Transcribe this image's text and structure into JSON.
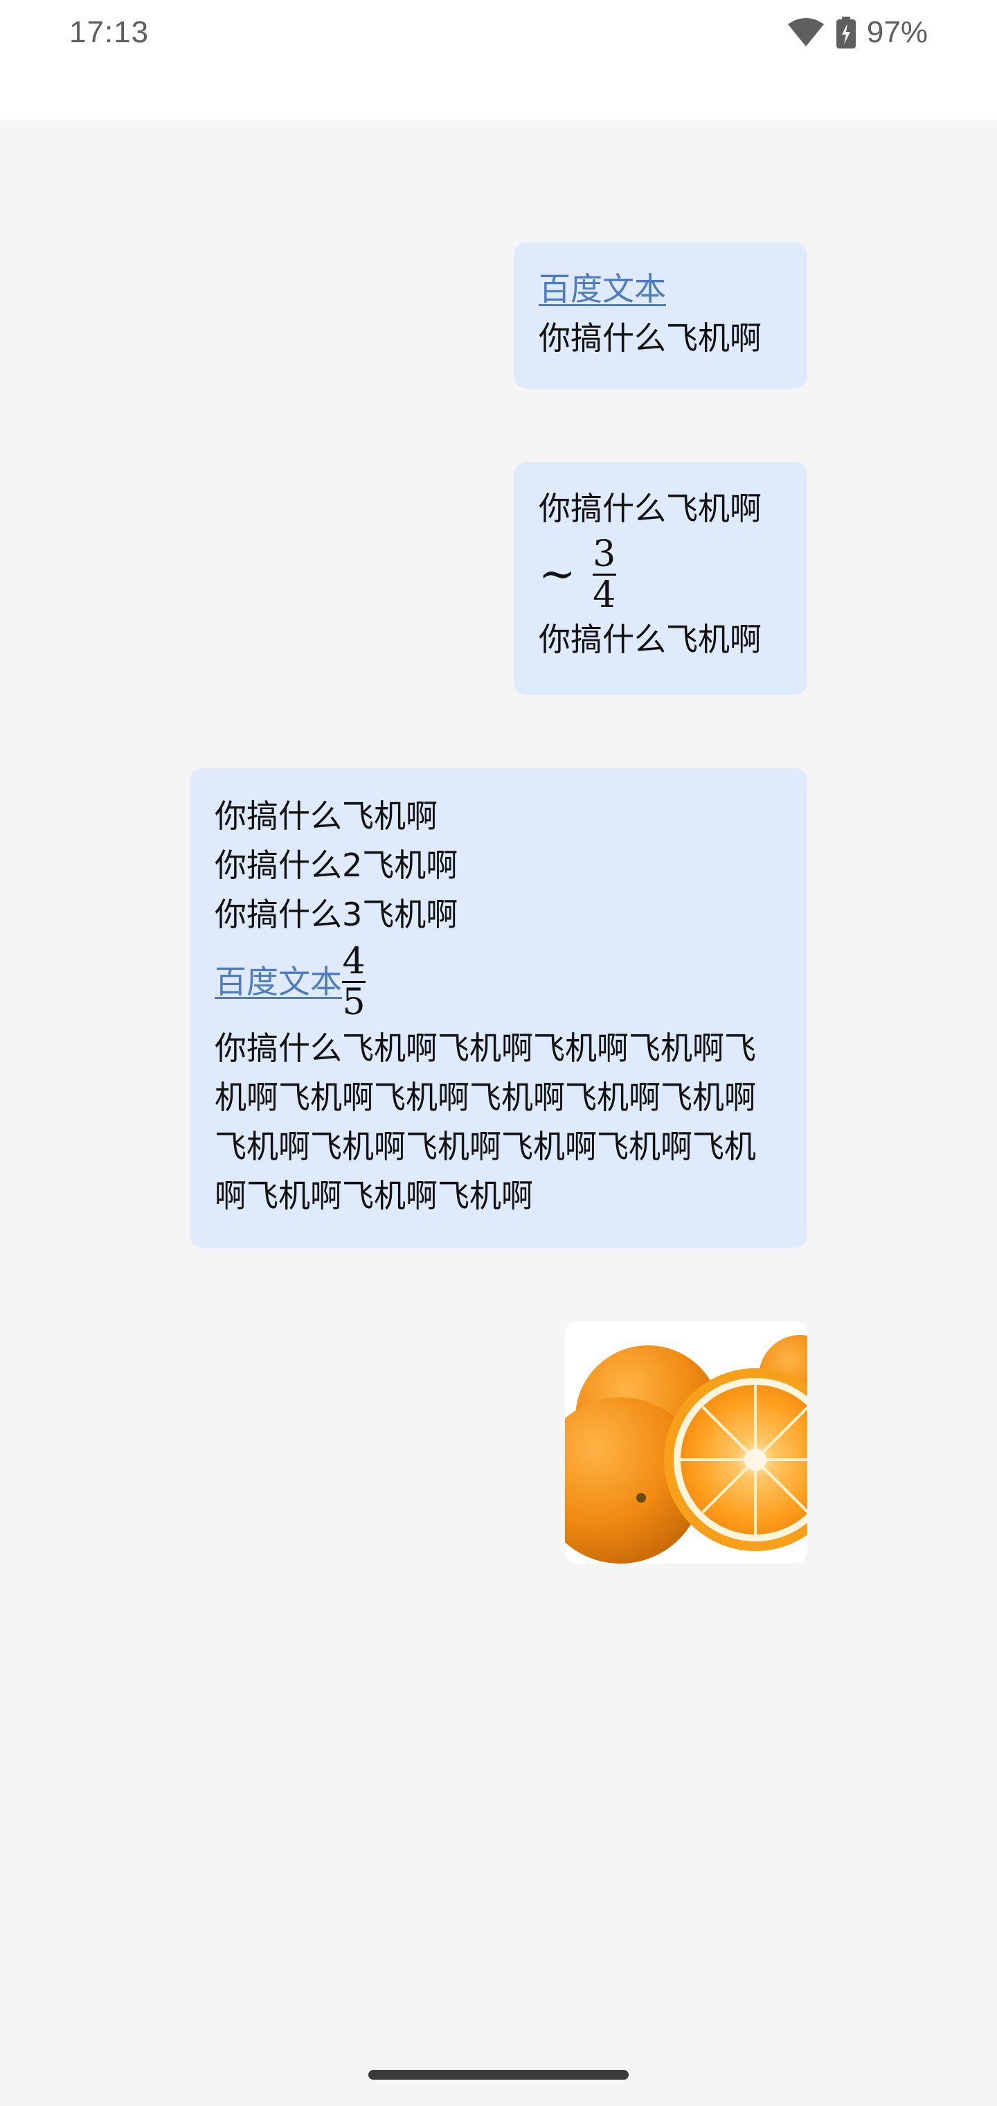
{
  "status_bar": {
    "time": "17:13",
    "battery_percent": "97%",
    "icons": [
      "wifi-icon",
      "battery-charging-icon"
    ]
  },
  "messages": [
    {
      "link_text": "百度文本",
      "text": "你搞什么飞机啊"
    },
    {
      "line1": "你搞什么飞机啊",
      "math_symbol": "∼",
      "fraction": {
        "numerator": "3",
        "denominator": "4"
      },
      "line2": "你搞什么飞机啊"
    },
    {
      "line1": "你搞什么飞机啊",
      "line2": "你搞什么2飞机啊",
      "line3": "你搞什么3飞机啊",
      "link_text": "百度文本",
      "fraction": {
        "numerator": "4",
        "denominator": "5"
      },
      "paragraph": "你搞什么飞机啊飞机啊飞机啊飞机啊飞机啊飞机啊飞机啊飞机啊飞机啊飞机啊飞机啊飞机啊飞机啊飞机啊飞机啊飞机啊飞机啊飞机啊飞机啊"
    },
    {
      "image": "oranges-image"
    }
  ],
  "colors": {
    "bubble": "#dfebfc",
    "background": "#f5f5f5",
    "link": "#4f7bbf"
  }
}
